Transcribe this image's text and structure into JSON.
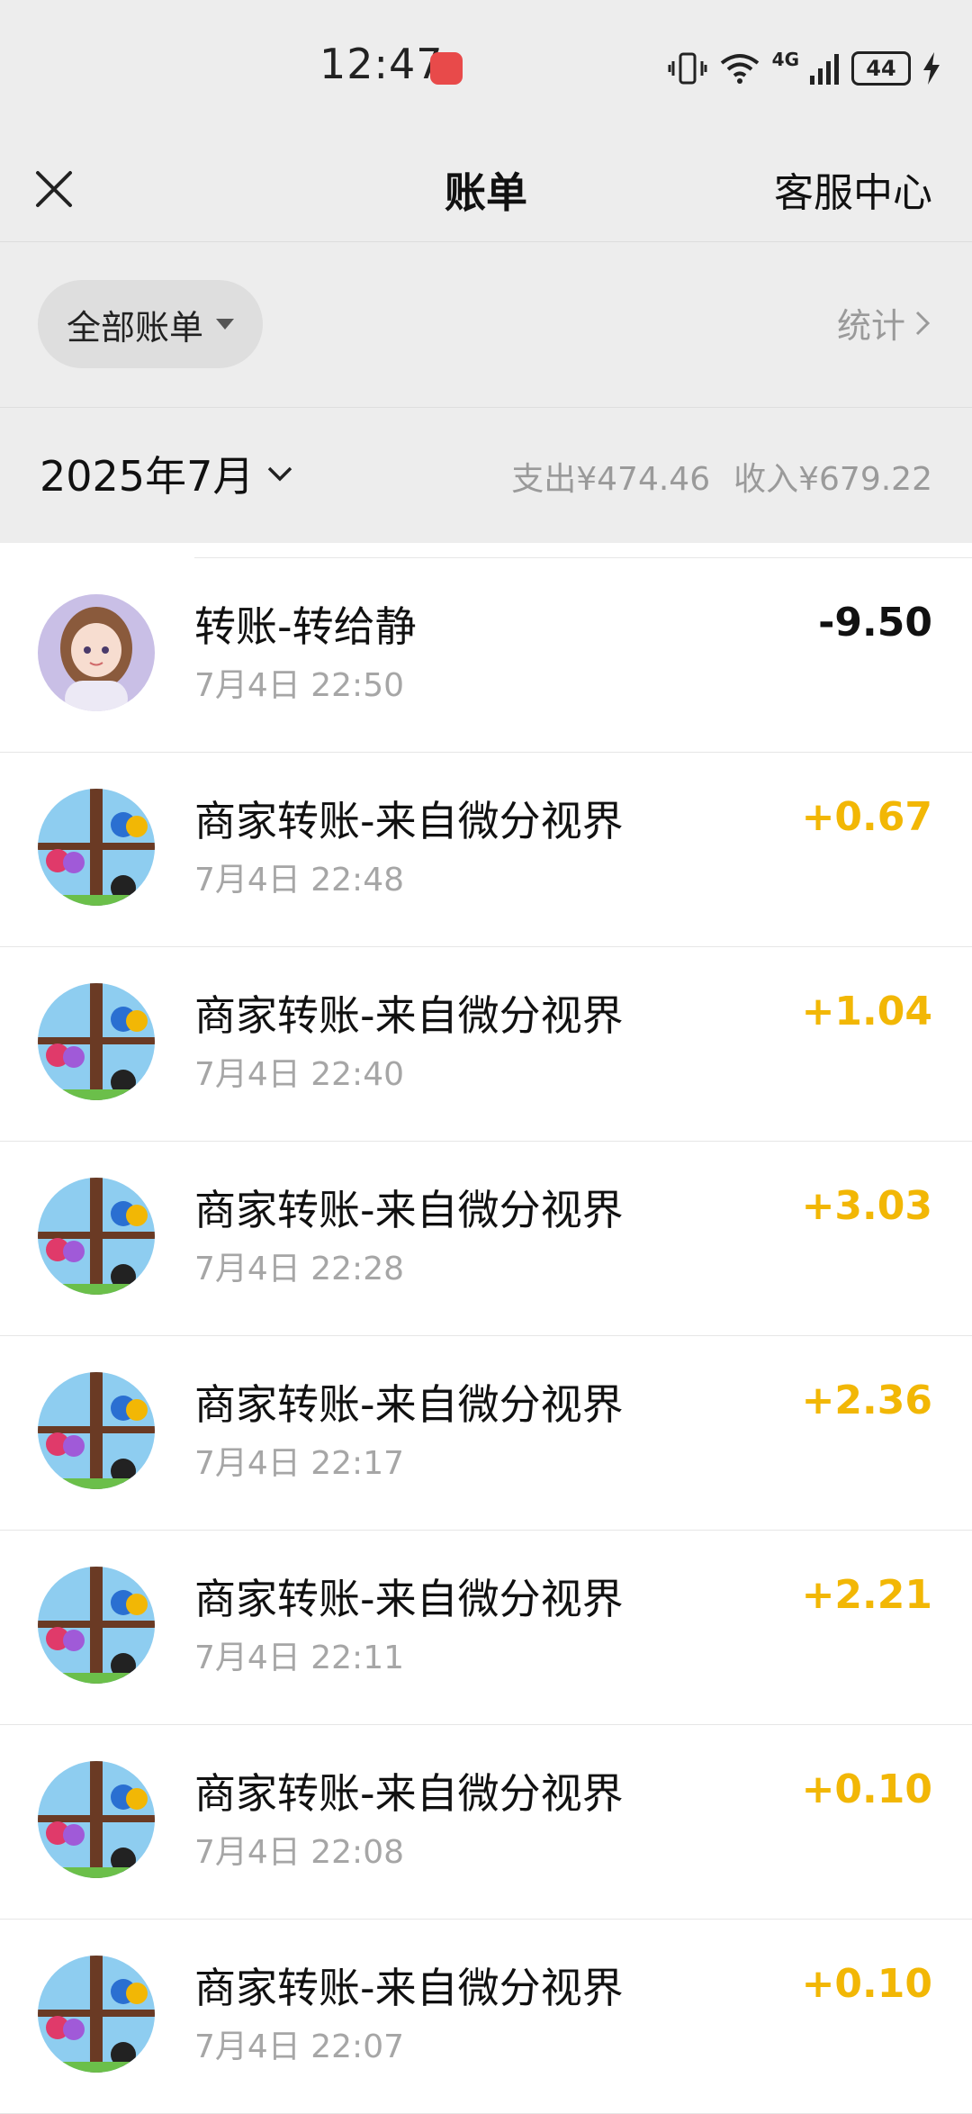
{
  "status_bar": {
    "time": "12:47",
    "network": "4G",
    "battery": "44"
  },
  "header": {
    "title": "账单",
    "service_label": "客服中心"
  },
  "filter": {
    "label": "全部账单",
    "stats_label": "统计"
  },
  "period": {
    "month": "2025年7月",
    "expense_label": "支出",
    "expense_value": "¥474.46",
    "income_label": "收入",
    "income_value": "¥679.22"
  },
  "transactions": [
    {
      "title": "转账-转给静",
      "time": "7月4日 22:50",
      "amount": "-9.50",
      "avatar": "girl-avatar"
    },
    {
      "title": "商家转账-来自微分视界",
      "time": "7月4日 22:48",
      "amount": "+0.67",
      "avatar": "birds-avatar"
    },
    {
      "title": "商家转账-来自微分视界",
      "time": "7月4日 22:40",
      "amount": "+1.04",
      "avatar": "birds-avatar"
    },
    {
      "title": "商家转账-来自微分视界",
      "time": "7月4日 22:28",
      "amount": "+3.03",
      "avatar": "birds-avatar"
    },
    {
      "title": "商家转账-来自微分视界",
      "time": "7月4日 22:17",
      "amount": "+2.36",
      "avatar": "birds-avatar"
    },
    {
      "title": "商家转账-来自微分视界",
      "time": "7月4日 22:11",
      "amount": "+2.21",
      "avatar": "birds-avatar"
    },
    {
      "title": "商家转账-来自微分视界",
      "time": "7月4日 22:08",
      "amount": "+0.10",
      "avatar": "birds-avatar"
    },
    {
      "title": "商家转账-来自微分视界",
      "time": "7月4日 22:07",
      "amount": "+0.10",
      "avatar": "birds-avatar"
    }
  ],
  "colors": {
    "income": "#f2b705",
    "expense": "#111111",
    "header_bg": "#ededed"
  }
}
